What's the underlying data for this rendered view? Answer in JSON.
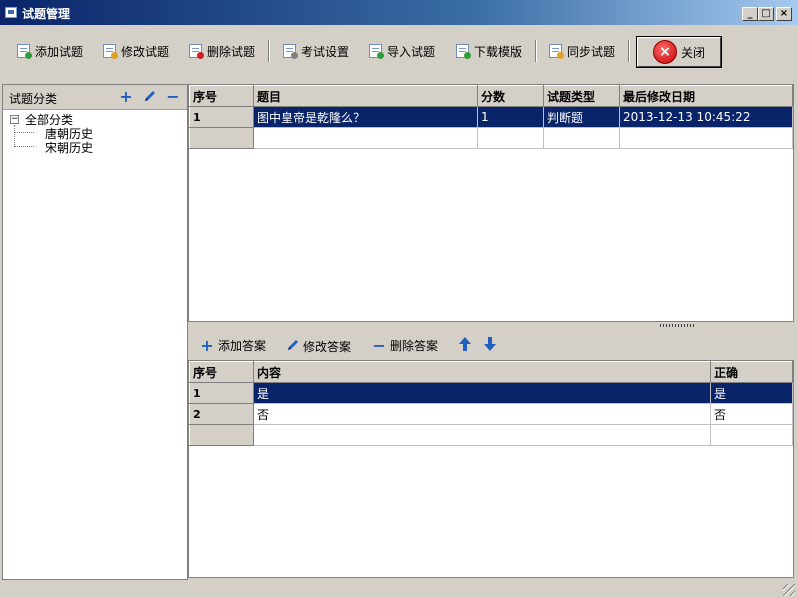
{
  "window": {
    "title": "试题管理",
    "controls": {
      "minimize": "_",
      "restore": "□",
      "close": "×"
    }
  },
  "toolbar": {
    "add_question": "添加试题",
    "edit_question": "修改试题",
    "delete_question": "删除试题",
    "exam_settings": "考试设置",
    "import_questions": "导入试题",
    "download_template": "下载模版",
    "sync_questions": "同步试题",
    "close": "关闭"
  },
  "categories": {
    "title": "试题分类",
    "add_icon": "plus-icon",
    "edit_icon": "pen-icon",
    "remove_icon": "minus-icon",
    "tree": {
      "root": "全部分类",
      "expander": "−",
      "children": [
        "唐朝历史",
        "宋朝历史"
      ]
    }
  },
  "questions": {
    "columns": [
      "序号",
      "题目",
      "分数",
      "试题类型",
      "最后修改日期"
    ],
    "rows": [
      {
        "index": "1",
        "title": "图中皇帝是乾隆么？",
        "score": "1",
        "type": "判断题",
        "modified": "2013-12-13 10:45:22",
        "selected": true
      }
    ]
  },
  "answer_toolbar": {
    "add_answer": "添加答案",
    "edit_answer": "修改答案",
    "delete_answer": "删除答案",
    "move_up_icon": "arrow-up-icon",
    "move_down_icon": "arrow-down-icon"
  },
  "answers": {
    "columns": [
      "序号",
      "内容",
      "正确"
    ],
    "rows": [
      {
        "index": "1",
        "content": "是",
        "correct": "是",
        "selected": true
      },
      {
        "index": "2",
        "content": "否",
        "correct": "否",
        "selected": false
      }
    ]
  },
  "colors": {
    "title_bar": "#0a246a",
    "selection": "#0a246a",
    "accent_icon": "#1f5fbf",
    "close_button": "#c40000",
    "window_bg": "#d4d0c8"
  }
}
